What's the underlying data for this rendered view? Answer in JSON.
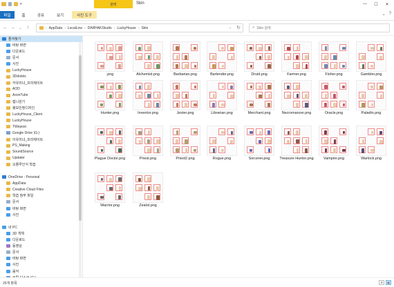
{
  "window": {
    "title": "Skin",
    "context_tab": "관리",
    "controls": [
      "—",
      "☐",
      "✕"
    ]
  },
  "ribbon": {
    "tabs": [
      {
        "label": "파일"
      },
      {
        "label": "홈"
      },
      {
        "label": "공유"
      },
      {
        "label": "보기"
      },
      {
        "label": "사진 도구"
      }
    ]
  },
  "address": {
    "segments": [
      "AppData",
      "LocalLow",
      "DARHAKStudio",
      "LuckyHouse",
      "Skin"
    ],
    "dropdown": "⌄",
    "refresh": "↻"
  },
  "search": {
    "placeholder": "Skin 검색"
  },
  "sidebar": {
    "items": [
      {
        "label": "즐겨찾기",
        "color": "#2a7fd4",
        "selected": true
      },
      {
        "label": "바탕 화면",
        "color": "#4a9ee8"
      },
      {
        "label": "다운로드",
        "color": "#4a9ee8"
      },
      {
        "label": "문서",
        "color": "#9aaec8"
      },
      {
        "label": "사진",
        "color": "#4a9ee8"
      },
      {
        "label": "LuckyHouse",
        "color": "#e8b84a"
      },
      {
        "label": "3Ddotetc",
        "color": "#e8b84a"
      },
      {
        "label": "카유미녀_프라제이트",
        "color": "#e8b84a"
      },
      {
        "label": "AOD",
        "color": "#e8b84a"
      },
      {
        "label": "AxonTube",
        "color": "#e8b84a"
      },
      {
        "label": "렙니원기",
        "color": "#e8b84a"
      },
      {
        "label": "봉보민정디자인",
        "color": "#e8b84a"
      },
      {
        "label": "LuckyHouse_Client",
        "color": "#e8b84a"
      },
      {
        "label": "LuckyHouse",
        "color": "#e8b84a"
      },
      {
        "label": "TWepost",
        "color": "#e8b84a"
      },
      {
        "label": "Google Drive (G:)",
        "color": "#7aa0c8"
      },
      {
        "label": "이유미녀_프라제이트",
        "color": "#e8b84a"
      },
      {
        "label": "PS_Making",
        "color": "#e8b84a"
      },
      {
        "label": "SoundSource",
        "color": "#e8b84a"
      },
      {
        "label": "Updater",
        "color": "#e8b84a"
      },
      {
        "label": "오뿡루인식 학습",
        "color": "#e8b84a"
      },
      {
        "label": "",
        "color": "#ffffff"
      },
      {
        "label": "OneDrive - Personal",
        "color": "#2a7fd4"
      },
      {
        "label": "AppData",
        "color": "#e8b84a"
      },
      {
        "label": "Creative Cloud Files",
        "color": "#e8b84a"
      },
      {
        "label": "학습 참부 파일",
        "color": "#e8b84a"
      },
      {
        "label": "문서",
        "color": "#9aaec8"
      },
      {
        "label": "바탕 화면",
        "color": "#4a9ee8"
      },
      {
        "label": "사진",
        "color": "#4a9ee8"
      },
      {
        "label": "",
        "color": "#ffffff"
      },
      {
        "label": "내 PC",
        "color": "#4a9ee8"
      },
      {
        "label": "3D 개체",
        "color": "#4a9ee8"
      },
      {
        "label": "다운로드",
        "color": "#4a9ee8"
      },
      {
        "label": "동영상",
        "color": "#9a7ac8"
      },
      {
        "label": "문서",
        "color": "#9aaec8"
      },
      {
        "label": "바탕 화면",
        "color": "#4a9ee8"
      },
      {
        "label": "사진",
        "color": "#4a9ee8"
      },
      {
        "label": "음악",
        "color": "#4a9ee8"
      },
      {
        "label": "로컬 디스크 (C:)",
        "color": "#7aa0c8"
      },
      {
        "label": "네트워크",
        "color": "#4a9ee8"
      }
    ]
  },
  "files": [
    {
      "name": ".png",
      "accent": "#d9a08a"
    },
    {
      "name": "Alchemist.png",
      "accent": "#6a9a6a"
    },
    {
      "name": "Barbarian.png",
      "accent": "#b07a4a"
    },
    {
      "name": "Bartender.png",
      "accent": "#c89a5a"
    },
    {
      "name": "Druid.png",
      "accent": "#8a6a4a"
    },
    {
      "name": "Farmer.png",
      "accent": "#b04a4a"
    },
    {
      "name": "Fisher.png",
      "accent": "#6a8ab0"
    },
    {
      "name": "Gambler.png",
      "accent": "#5a7a5a"
    },
    {
      "name": "Hunter.png",
      "accent": "#7a9a5a"
    },
    {
      "name": "Inventor.png",
      "accent": "#6a8aa0"
    },
    {
      "name": "Jester.png",
      "accent": "#c07a5a"
    },
    {
      "name": "Librarian.png",
      "accent": "#8a7ab0"
    },
    {
      "name": "Merchant.png",
      "accent": "#a07a4a"
    },
    {
      "name": "Necromancer.png",
      "accent": "#5a5a7a"
    },
    {
      "name": "Oracle.png",
      "accent": "#c05a6a"
    },
    {
      "name": "Paladin.png",
      "accent": "#b09a5a"
    },
    {
      "name": "Plague Doctor.png",
      "accent": "#4a6a5a"
    },
    {
      "name": "Priest.png",
      "accent": "#a0a080"
    },
    {
      "name": "Priest2.png",
      "accent": "#b0a070"
    },
    {
      "name": "Rogue.png",
      "accent": "#5a6a8a"
    },
    {
      "name": "Sorcerer.png",
      "accent": "#6a6ab0"
    },
    {
      "name": "Treasure Hunter.png",
      "accent": "#8a5a4a"
    },
    {
      "name": "Vampire.png",
      "accent": "#7a3a4a"
    },
    {
      "name": "Warlock.png",
      "accent": "#5a4a7a"
    },
    {
      "name": "Warrior.png",
      "accent": "#6a6a6a"
    },
    {
      "name": "Zealot.png",
      "accent": "#8a5a3a"
    }
  ],
  "status": {
    "text": "26개 항목"
  },
  "view_buttons": [
    "☰",
    "▦"
  ]
}
